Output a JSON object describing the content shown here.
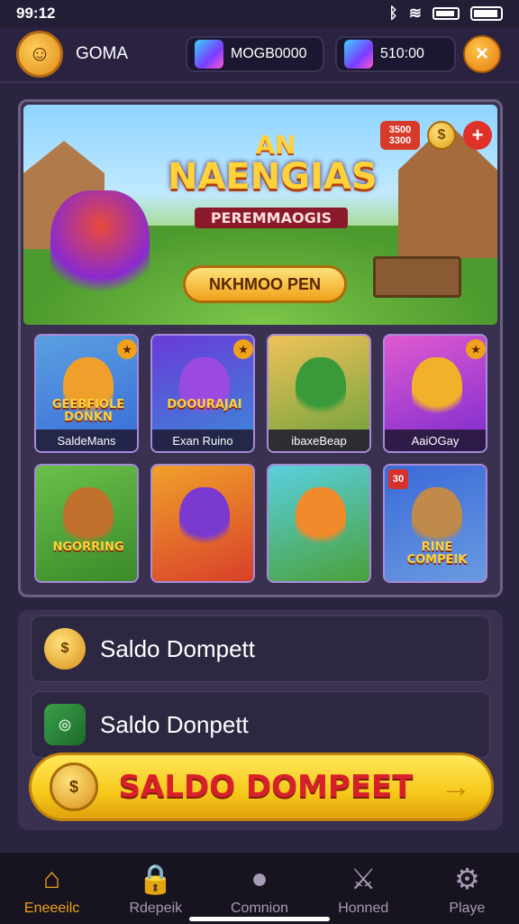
{
  "status_bar": {
    "time": "99:12",
    "icons": [
      "bluetooth-icon",
      "wifi-icon",
      "battery-icon",
      "battery-icon"
    ]
  },
  "header": {
    "username": "GOMA",
    "currency_one": "MOGB0000",
    "currency_two": "510:00",
    "close_label": "×"
  },
  "banner": {
    "title_top": "AN",
    "title": "NAENGIAS",
    "subtitle": "PEREMMAOGIS",
    "cta_label": "NKHMOO PEN",
    "badge": "3500 3300",
    "coin_label": "$",
    "plus_label": "+"
  },
  "games": [
    {
      "label": "SaldeMans",
      "art_text": "GEEBFIOLE DONKN",
      "colors": [
        "#5aa0e0",
        "#3a6ad8"
      ],
      "char": "#f0a02a",
      "corner": "★"
    },
    {
      "label": "Exan Ruino",
      "art_text": "DOOURAJAI",
      "colors": [
        "#6a3ad8",
        "#3a8ad8"
      ],
      "char": "#9a4ae0",
      "corner": "★"
    },
    {
      "label": "ibaxeBeap",
      "art_text": "",
      "colors": [
        "#f0c25a",
        "#6aa03a"
      ],
      "char": "#3a9a3a",
      "corner": ""
    },
    {
      "label": "AaiOGay",
      "art_text": "",
      "colors": [
        "#e05ad0",
        "#7a2ad0"
      ],
      "char": "#f0b22a",
      "corner": "★"
    },
    {
      "label": "",
      "art_text": "NGORRING",
      "colors": [
        "#6ac04a",
        "#3a8a2a"
      ],
      "char": "#c0702a",
      "corner": ""
    },
    {
      "label": "",
      "art_text": "",
      "colors": [
        "#f0a02a",
        "#d8402a"
      ],
      "char": "#7a3ad0",
      "corner": ""
    },
    {
      "label": "",
      "art_text": "",
      "colors": [
        "#5ad0e0",
        "#4aa03a"
      ],
      "char": "#f08a2a",
      "corner": ""
    },
    {
      "label": "",
      "art_text": "RINE COMPEIK",
      "colors": [
        "#3a6ad8",
        "#6a9ae0"
      ],
      "char": "#c08a4a",
      "corner": "30"
    }
  ],
  "wallet": {
    "row_one": "Saldo Dompett",
    "row_two": "Saldo Donpett",
    "button": "SALDO DOMPEET",
    "button_arrow": "→"
  },
  "nav": [
    {
      "label": "Eneeeilc",
      "icon": "home-icon",
      "glyph": "⌂"
    },
    {
      "label": "Rdepeik",
      "icon": "lock-icon",
      "glyph": "🔒"
    },
    {
      "label": "Comnion",
      "icon": "mask-icon",
      "glyph": "●"
    },
    {
      "label": "Honned",
      "icon": "sword-icon",
      "glyph": "⚔"
    },
    {
      "label": "Playe",
      "icon": "gear-icon",
      "glyph": "⚙"
    }
  ],
  "colors": {
    "accent": "#f0a21a",
    "background": "#2b2440",
    "panel": "#3a3150"
  }
}
